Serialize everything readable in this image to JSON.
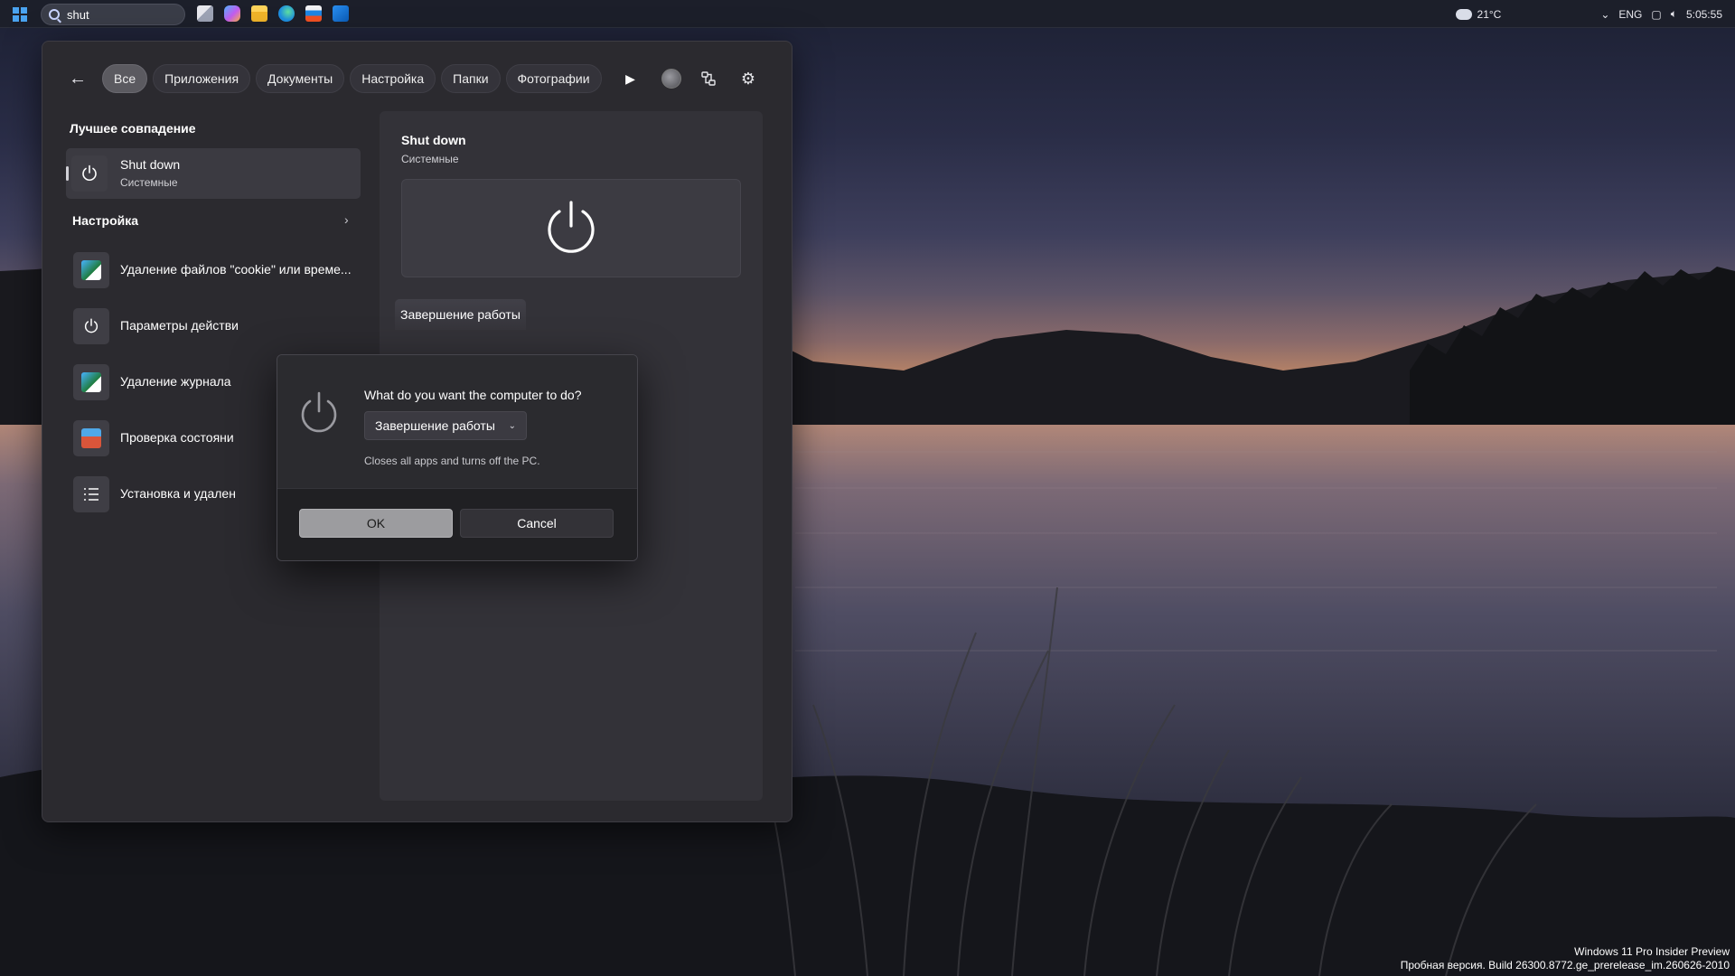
{
  "taskbar": {
    "search_value": "shut",
    "weather": "21°C",
    "language": "ENG",
    "clock": "5:05:55",
    "pinned_apps": [
      "task-view",
      "copilot",
      "file-explorer",
      "edge",
      "store",
      "outlook"
    ]
  },
  "flyout": {
    "filters": [
      "Все",
      "Приложения",
      "Документы",
      "Настройка",
      "Папки",
      "Фотографии"
    ],
    "best_match_heading": "Лучшее совпадение",
    "best_match": {
      "title": "Shut down",
      "subtitle": "Системные"
    },
    "settings_heading": "Настройка",
    "settings_items": [
      {
        "label": "Удаление файлов \"cookie\" или време...",
        "icon": "internet-options-icon"
      },
      {
        "label": "Параметры действи",
        "icon": "power-icon"
      },
      {
        "label": "Удаление журнала",
        "icon": "internet-options-icon"
      },
      {
        "label": "Проверка состояни",
        "icon": "firewall-icon"
      },
      {
        "label": "Установка и удален",
        "icon": "list-icon"
      }
    ],
    "detail": {
      "title": "Shut down",
      "subtitle": "Системные",
      "action": "Завершение работы"
    }
  },
  "dialog": {
    "question": "What do you want the computer to do?",
    "selected_option": "Завершение работы",
    "description": "Closes all apps and turns off the PC.",
    "ok_label": "OK",
    "cancel_label": "Cancel"
  },
  "watermark": {
    "line1": "Windows 11 Pro Insider Preview",
    "line2": "Пробная версия. Build 26300.8772.ge_prerelease_im.260626-2010"
  },
  "colors": {
    "accent": "#4aa3f0",
    "panel": "#2b2a2f",
    "dialog_footer": "#202023",
    "ok_button": "#9c9c9f"
  }
}
